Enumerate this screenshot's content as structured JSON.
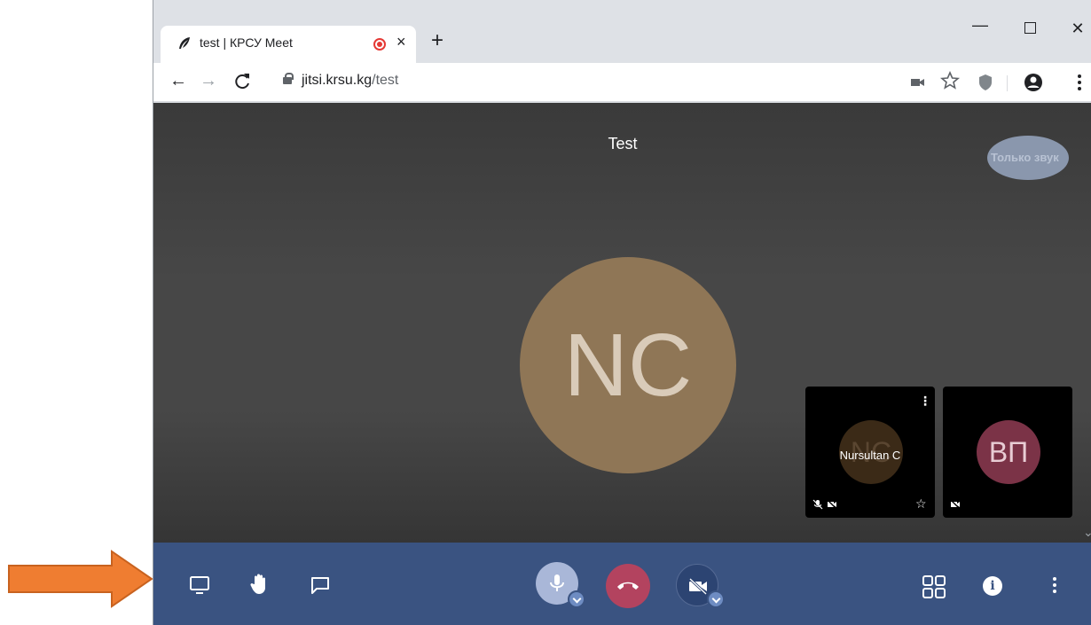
{
  "browser": {
    "tab": {
      "title": "test | КРСУ Meet",
      "close": "×"
    },
    "new_tab": "+",
    "window_controls": {
      "minimize": "—",
      "close": "✕"
    },
    "nav": {
      "back": "←",
      "forward": "→",
      "reload": "C"
    },
    "address": {
      "host": "jitsi.krsu.kg",
      "path": "/test"
    },
    "toolbar_icons": [
      "camera-icon",
      "star-icon",
      "extension-icon",
      "profile-icon",
      "menu-icon"
    ]
  },
  "meeting": {
    "room_title": "Test",
    "audio_only_label": "Только звук",
    "main_avatar_initials": "NC",
    "participants": [
      {
        "initials": "NC",
        "name": "Nursultan C",
        "muted_mic": true,
        "video_off": true
      },
      {
        "initials": "ВП",
        "name": "",
        "muted_mic": false,
        "video_off": true
      }
    ]
  },
  "toolbar": {
    "left": [
      "screen-share-icon",
      "raise-hand-icon",
      "chat-icon"
    ],
    "center": [
      "microphone-icon",
      "hangup-icon",
      "camera-off-icon"
    ],
    "right": [
      "tile-view-icon",
      "info-icon",
      "more-icon"
    ],
    "info_glyph": "i"
  },
  "colors": {
    "toolbar_bg": "#3a5381",
    "hangup": "#b3435f",
    "main_avatar": "#8f7656",
    "participant_2_avatar": "#7b3347",
    "annotation_arrow": "#ef7d31"
  }
}
